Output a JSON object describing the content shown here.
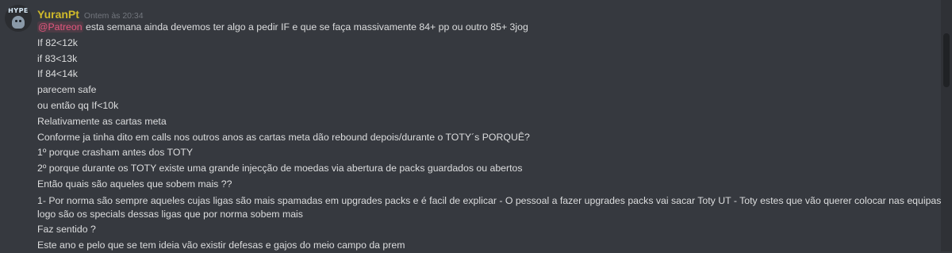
{
  "message": {
    "avatar_text": "HYPE",
    "username": "YuranPt",
    "timestamp": "Ontem às 20:34",
    "mention": "@Patreon",
    "first_line_rest": " esta semana ainda devemos ter algo a pedir IF e que se faça massivamente 84+ pp ou outro 85+ 3jog",
    "lines": [
      "If 82<12k",
      "if 83<13k",
      "If 84<14k",
      "parecem safe",
      "ou então qq If<10k",
      "Relativamente as cartas meta",
      "Conforme ja tinha dito em calls nos outros anos as cartas meta dão rebound depois/durante o TOTY´s PORQUÊ?",
      "1º porque crasham antes dos TOTY",
      "2º porque durante os TOTY existe uma grande injecção de moedas via abertura de packs guardados ou abertos",
      "Então quais são aqueles que sobem mais ??"
    ],
    "wrapped_line": "1- Por norma são sempre aqueles cujas ligas são mais spamadas em upgrades packs e é facil de explicar - O pessoal a fazer upgrades packs vai sacar Toty UT - Toty estes que vão querer colocar nas equipas logo são os specials dessas ligas que por norma sobem mais",
    "after_lines": [
      "Faz sentido ?",
      "Este ano e pelo que se tem ideia vão existir defesas e gajos do meio campo da prem"
    ]
  }
}
